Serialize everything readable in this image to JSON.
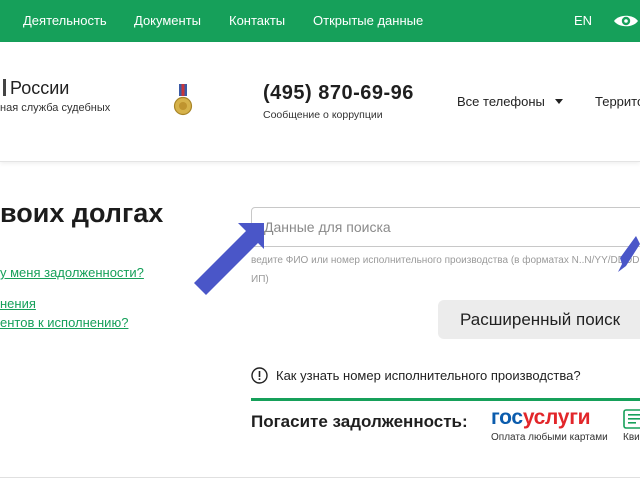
{
  "topnav": {
    "items": [
      "Деятельность",
      "Документы",
      "Контакты",
      "Открытые данные"
    ],
    "lang": "EN",
    "bg_color": "#16a05a",
    "icons": {
      "accessibility": "eye-icon"
    }
  },
  "header": {
    "org_name": "России",
    "org_sub": "ная служба судебных",
    "emblem_icon": "medal-icon",
    "phone": "(495) 870-69-96",
    "phone_sub": "Сообщение о коррупции",
    "all_phones": "Все телефоны",
    "territory": "Территор"
  },
  "main": {
    "title": "воих долгах",
    "links": [
      "у меня задолженности?",
      "нения",
      "ентов к исполнению?"
    ],
    "search": {
      "placeholder": "Данные для поиска",
      "hint": "ведите ФИО или номер исполнительного производства (в форматах N..N/YY/DDDDD-ИП)"
    },
    "advanced_button": "Расширенный поиск",
    "info_link": "Как узнать номер исполнительного производства?",
    "pay": {
      "title": "Погасите задолженность:",
      "gos_a": "гос",
      "gos_b": "услуги",
      "gos_sub": "Оплата любыми картами",
      "kvit": "Кви"
    },
    "accent_color": "#16a05a"
  }
}
